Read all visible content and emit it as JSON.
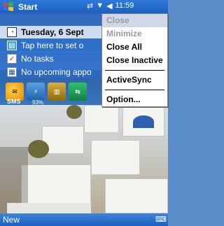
{
  "titlebar": {
    "title": "Start",
    "time": "11:59"
  },
  "today": {
    "date": "Tuesday, 6 Sept",
    "owner_prompt": "Tap here to set o",
    "tasks": "No tasks",
    "appointments": "No upcoming appo"
  },
  "status": {
    "sms_label": "SMS",
    "battery_label": "93%"
  },
  "menu": {
    "items": [
      {
        "label": "Close",
        "enabled": false
      },
      {
        "label": "Minimize",
        "enabled": false
      },
      {
        "label": "Close All",
        "enabled": true
      },
      {
        "label": "Close Inactive",
        "enabled": true
      },
      {
        "label": "ActiveSync",
        "enabled": true
      },
      {
        "label": "Option...",
        "enabled": true
      }
    ]
  },
  "bottombar": {
    "new_label": "New"
  },
  "icons": {
    "start": "windows-flag-icon",
    "connectivity": "connectivity-icon",
    "signal": "signal-icon",
    "volume": "speaker-icon",
    "keyboard": "keyboard-icon"
  },
  "colors": {
    "titlebar": "#1d5fc0",
    "menu_bg": "#ffffff",
    "disabled_text": "#9a9a9a"
  }
}
